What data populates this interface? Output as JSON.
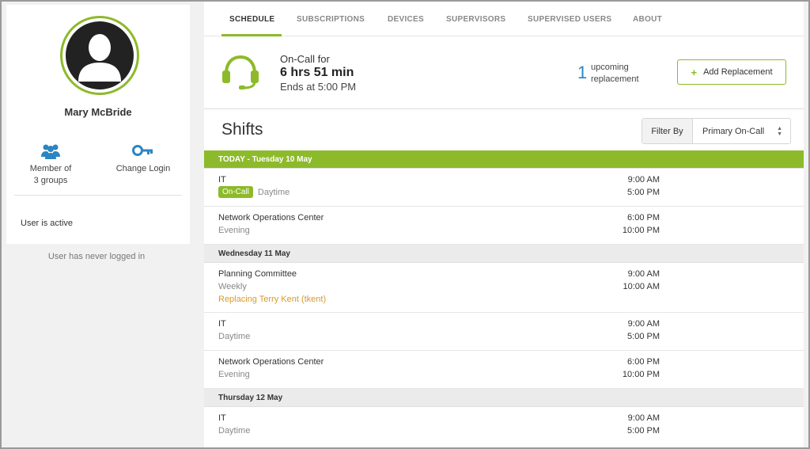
{
  "user": {
    "name": "Mary McBride",
    "groups_label_line1": "Member of",
    "groups_label_line2": "3 groups",
    "change_login_label": "Change Login",
    "status": "User is active",
    "last_login": "User has never logged in"
  },
  "tabs": [
    {
      "label": "SCHEDULE",
      "active": true
    },
    {
      "label": "SUBSCRIPTIONS",
      "active": false
    },
    {
      "label": "DEVICES",
      "active": false
    },
    {
      "label": "SUPERVISORS",
      "active": false
    },
    {
      "label": "SUPERVISED USERS",
      "active": false
    },
    {
      "label": "ABOUT",
      "active": false
    }
  ],
  "oncall": {
    "label": "On-Call for",
    "duration": "6 hrs 51 min",
    "ends": "Ends at 5:00 PM",
    "upcoming_count": "1",
    "upcoming_line1": "upcoming",
    "upcoming_line2": "replacement",
    "add_button": "Add Replacement"
  },
  "shifts": {
    "title": "Shifts",
    "filter_label": "Filter By",
    "filter_value": "Primary On-Call",
    "days": [
      {
        "header": "TODAY - Tuesday 10 May",
        "items": [
          {
            "name": "IT",
            "badge": "On-Call",
            "sub": "Daytime",
            "start": "9:00 AM",
            "end": "5:00 PM"
          },
          {
            "name": "Network Operations Center",
            "sub": "Evening",
            "start": "6:00 PM",
            "end": "10:00 PM"
          }
        ]
      },
      {
        "header": "Wednesday 11 May",
        "items": [
          {
            "name": "Planning Committee",
            "sub": "Weekly",
            "replacing": "Replacing Terry Kent (tkent)",
            "start": "9:00 AM",
            "end": "10:00 AM"
          },
          {
            "name": "IT",
            "sub": "Daytime",
            "start": "9:00 AM",
            "end": "5:00 PM"
          },
          {
            "name": "Network Operations Center",
            "sub": "Evening",
            "start": "6:00 PM",
            "end": "10:00 PM"
          }
        ]
      },
      {
        "header": "Thursday 12 May",
        "items": [
          {
            "name": "IT",
            "sub": "Daytime",
            "start": "9:00 AM",
            "end": "5:00 PM"
          }
        ]
      }
    ]
  },
  "colors": {
    "accent": "#8dba2a",
    "link_blue": "#2a86c2",
    "replacing": "#d99a2b"
  }
}
